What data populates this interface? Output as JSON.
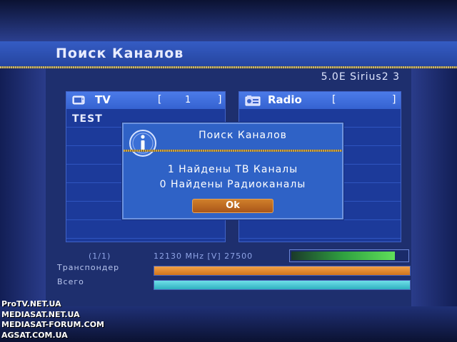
{
  "screen": {
    "title": "Поиск Каналов",
    "satellite": "5.0E Sirius2 3"
  },
  "tv_panel": {
    "label": "TV",
    "bracket_open": "[",
    "bracket_close": "]",
    "count": "1",
    "channels": [
      "TEST"
    ],
    "icon": "tv-icon"
  },
  "radio_panel": {
    "label": "Radio",
    "bracket_open": "[",
    "bracket_close": "]",
    "count": "",
    "icon": "radio-icon"
  },
  "dialog": {
    "title": "Поиск Каналов",
    "line1": "1 Найдены ТВ Каналы",
    "line2": "0 Найдены Радиоканалы",
    "ok_label": "Ok",
    "icon": "info-icon"
  },
  "status": {
    "index": "(1/1)",
    "frequency": "12130 MHz [V] 27500",
    "signal_level": 0.9,
    "transponder_label": "Транспондер",
    "total_label": "Всего",
    "transponder_progress": 1.0,
    "total_progress": 1.0
  },
  "watermark": {
    "lines": [
      "ProTV.NET.UA",
      "MEDIASAT.NET.UA",
      "MEDIASAT-FORUM.COM",
      "AGSAT.COM.UA"
    ]
  },
  "colors": {
    "accent_orange": "#d0741c",
    "accent_cyan": "#2fb0c0",
    "panel_blue": "#1c3a9a",
    "signal_green": "#5fe05a"
  }
}
